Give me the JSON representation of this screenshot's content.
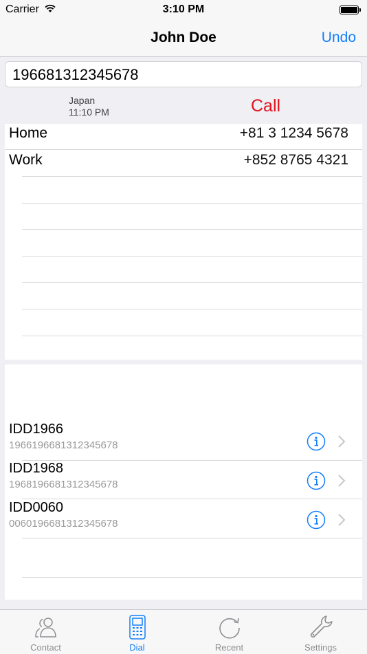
{
  "status_bar": {
    "carrier": "Carrier",
    "time": "3:10 PM"
  },
  "nav": {
    "title": "John Doe",
    "undo_label": "Undo"
  },
  "dial": {
    "number": "196681312345678",
    "country": "Japan",
    "local_time": "11:10 PM",
    "call_label": "Call"
  },
  "phones": [
    {
      "label": "Home",
      "number": "+81 3 1234 5678"
    },
    {
      "label": "Work",
      "number": "+852 8765 4321"
    }
  ],
  "idd_options": [
    {
      "title": "IDD1966",
      "subtitle": "1966196681312345678"
    },
    {
      "title": "IDD1968",
      "subtitle": "1968196681312345678"
    },
    {
      "title": "IDD0060",
      "subtitle": "0060196681312345678"
    }
  ],
  "tabs": [
    {
      "label": "Contact",
      "icon": "contacts-icon"
    },
    {
      "label": "Dial",
      "icon": "dial-icon",
      "active": true
    },
    {
      "label": "Recent",
      "icon": "recent-icon"
    },
    {
      "label": "Settings",
      "icon": "settings-icon"
    }
  ],
  "colors": {
    "accent": "#147efb",
    "call": "#e0141e",
    "inactive_tab": "#8e8e93"
  }
}
